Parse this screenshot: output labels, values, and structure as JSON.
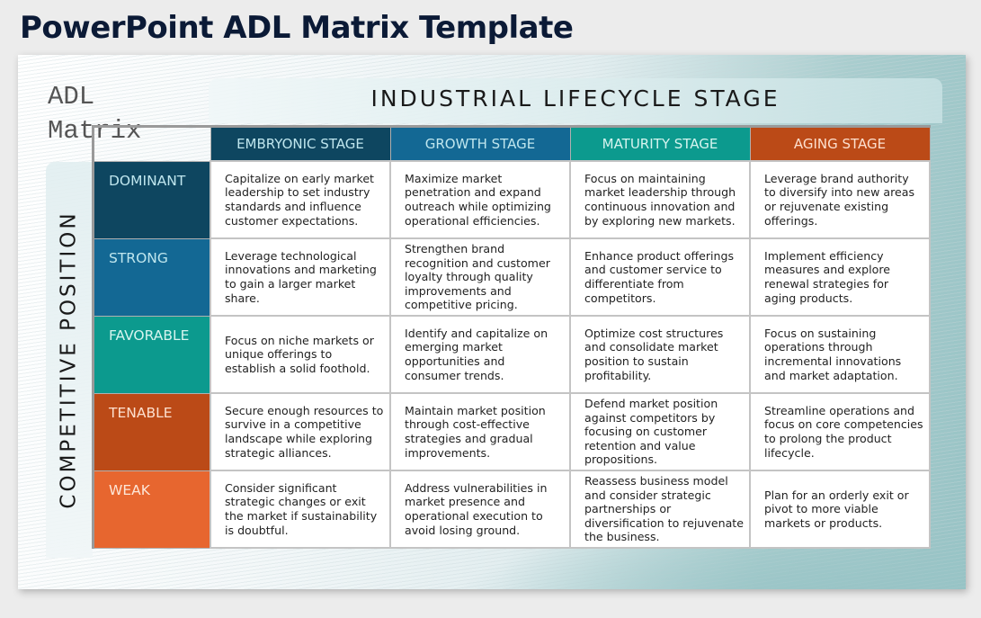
{
  "page": {
    "title": "PowerPoint ADL Matrix Template"
  },
  "slide": {
    "matrix_title_line1": "ADL",
    "matrix_title_line2": "Matrix",
    "column_axis_title": "INDUSTRIAL LIFECYCLE STAGE",
    "row_axis_title": "COMPETITIVE POSITION",
    "stages": [
      {
        "label": "EMBRYONIC STAGE",
        "bg": "#0e4660",
        "fg": "#bfe6ee"
      },
      {
        "label": "GROWTH STAGE",
        "bg": "#136894",
        "fg": "#bfe6ee"
      },
      {
        "label": "MATURITY STAGE",
        "bg": "#0c9a8e",
        "fg": "#d6f4ef"
      },
      {
        "label": "AGING STAGE",
        "bg": "#bb4a17",
        "fg": "#fde0cf"
      }
    ],
    "positions": [
      {
        "label": "DOMINANT",
        "bg": "#0e4660",
        "fg": "#bfe6ee"
      },
      {
        "label": "STRONG",
        "bg": "#136894",
        "fg": "#bfe6ee"
      },
      {
        "label": "FAVORABLE",
        "bg": "#0c9a8e",
        "fg": "#d6f4ef"
      },
      {
        "label": "TENABLE",
        "bg": "#bb4a17",
        "fg": "#fde0cf"
      },
      {
        "label": "WEAK",
        "bg": "#e7662f",
        "fg": "#fde6d8"
      }
    ],
    "rows": [
      [
        "Capitalize on early market leadership to set industry standards and influence customer expectations.",
        "Maximize market penetration and expand outreach while optimizing operational efficiencies.",
        "Focus on maintaining market leadership through continuous innovation and by exploring new markets.",
        "Leverage brand authority to diversify into new areas or rejuvenate existing offerings."
      ],
      [
        "Leverage technological innovations and marketing to gain a larger market share.",
        "Strengthen brand recognition and customer loyalty through quality improvements and competitive pricing.",
        "Enhance product offerings and customer service to differentiate from competitors.",
        "Implement efficiency measures and explore renewal strategies for aging products."
      ],
      [
        "Focus on niche markets or unique offerings to establish a solid foothold.",
        "Identify and capitalize on emerging market opportunities and consumer trends.",
        "Optimize cost structures and consolidate market position to sustain profitability.",
        "Focus on sustaining operations through incremental innovations and market adaptation."
      ],
      [
        "Secure enough resources to survive in a competitive landscape while exploring strategic alliances.",
        "Maintain market position through cost-effective strategies and gradual improvements.",
        "Defend market position against competitors by focusing on customer retention and value propositions.",
        "Streamline operations and focus on core competencies to prolong the product lifecycle."
      ],
      [
        "Consider significant strategic changes or exit the market if sustainability is doubtful.",
        "Address vulnerabilities in market presence and operational execution to avoid losing ground.",
        "Reassess business model and consider strategic partnerships or diversification to rejuvenate the business.",
        "Plan for an orderly exit or pivot to more viable markets or products."
      ]
    ]
  }
}
